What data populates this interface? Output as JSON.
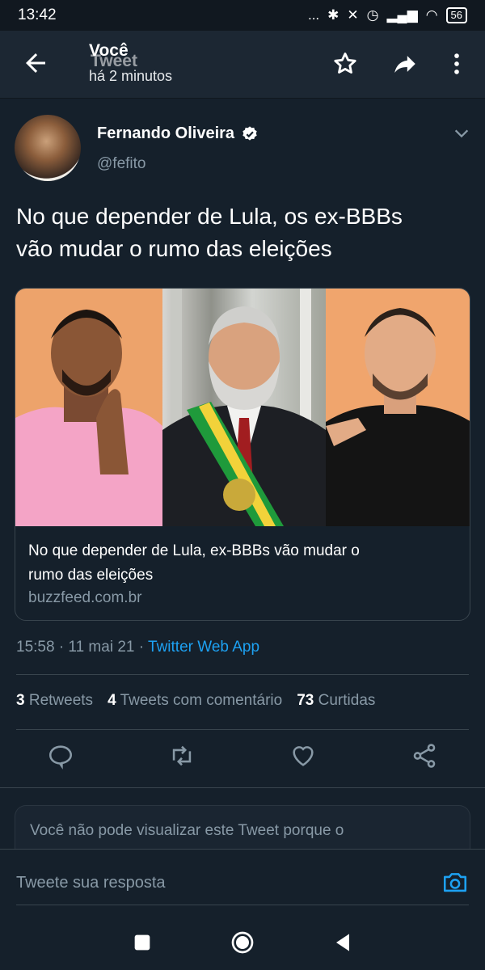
{
  "status_bar": {
    "time": "13:42",
    "signal_text": "...",
    "battery": "56"
  },
  "header": {
    "title": "Você",
    "overlay_title": "Tweet",
    "subtitle": "há 2 minutos"
  },
  "tweet": {
    "author_name": "Fernando Oliveira",
    "handle": "@fefito",
    "text_line1": "No que depender de Lula, os ex-BBBs",
    "text_line2": "vão mudar o rumo das eleições",
    "card": {
      "title_line1": "No que depender de Lula, ex-BBBs vão mudar o",
      "title_line2": "rumo das eleições",
      "domain": "buzzfeed.com.br"
    },
    "timestamp": "15:58 · 11 mai 21 · ",
    "source_app": "Twitter Web App",
    "stats": {
      "retweets_count": "3",
      "retweets_label": "Retweets",
      "quotes_count": "4",
      "quotes_label": "Tweets com comentário",
      "likes_count": "73",
      "likes_label": "Curtidas"
    }
  },
  "notice": {
    "text": "Você não pode visualizar este Tweet porque o"
  },
  "reply": {
    "placeholder": "Tweete sua resposta"
  },
  "colors": {
    "background": "#15202b",
    "accent": "#1da1f2",
    "muted": "#8899a6"
  },
  "icons": [
    "back-arrow-icon",
    "star-icon",
    "share-arrow-icon",
    "more-vertical-icon",
    "verified-badge-icon",
    "chevron-down-icon",
    "reply-icon",
    "retweet-icon",
    "like-icon",
    "share-icon",
    "camera-icon",
    "stop-square-icon",
    "home-circle-icon",
    "back-triangle-icon"
  ]
}
